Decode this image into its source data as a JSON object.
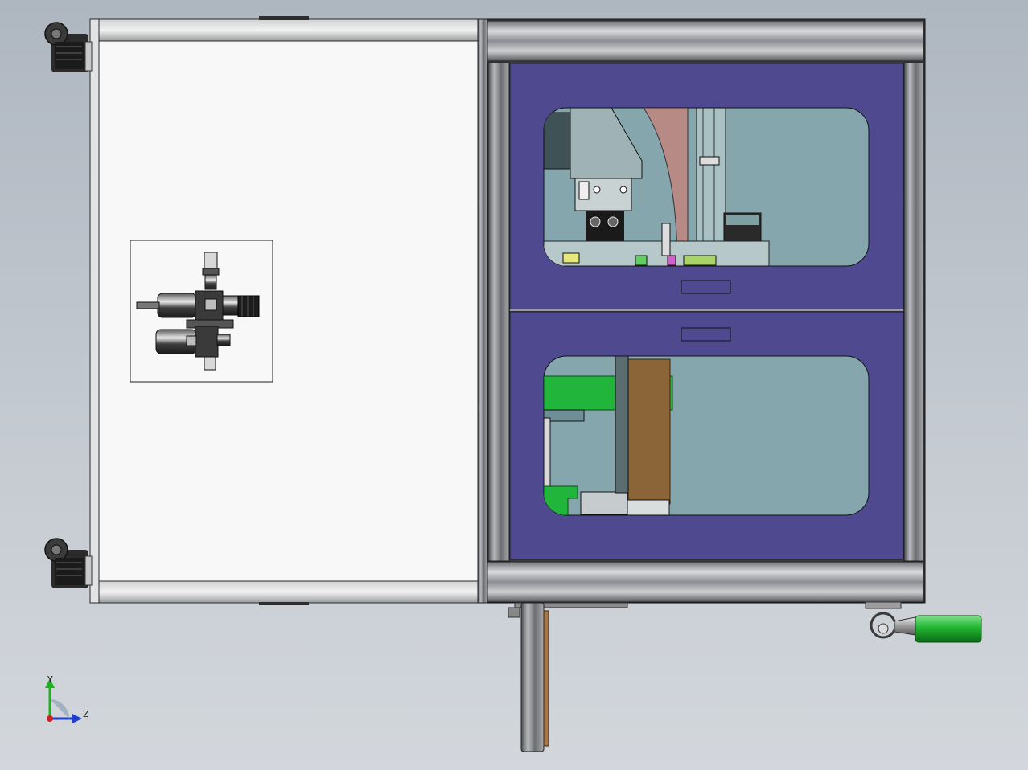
{
  "viewport": {
    "background_top": "#aeb6c0",
    "background_bottom": "#d3d7dc"
  },
  "model": {
    "panel_fill": "#f8f8f8",
    "door_color": "#4f4a90",
    "window_color": "#86a6ae",
    "frame_color": "#3c3d40",
    "accent_green": "#22b53c",
    "accent_brown": "#8b6537",
    "handle_green": "#21b531",
    "axis_y_color": "#1bb51b",
    "axis_z_color": "#1f3fd4",
    "axis_origin_color": "#d02020"
  },
  "triad": {
    "y_label": "Y",
    "z_label": "Z"
  }
}
